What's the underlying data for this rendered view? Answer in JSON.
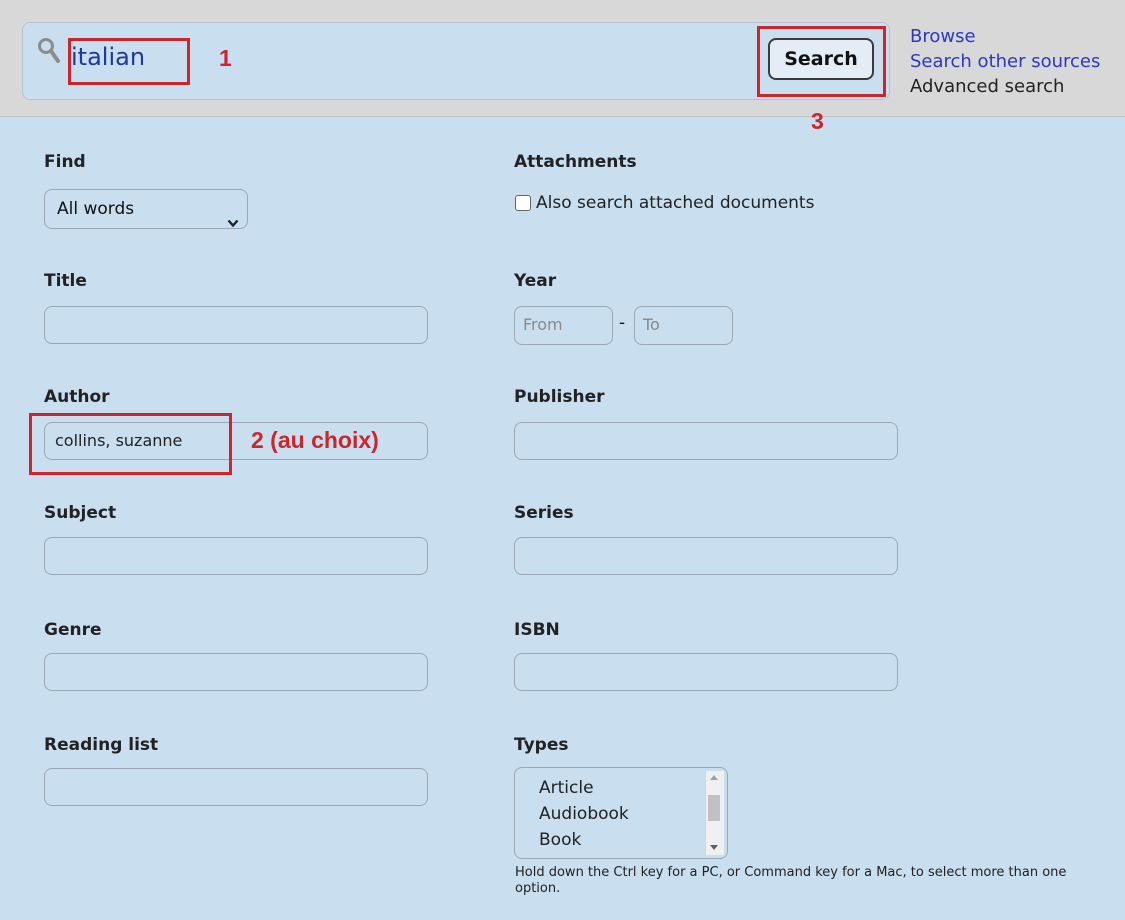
{
  "search": {
    "query": "italian",
    "button_label": "Search"
  },
  "top_links": {
    "browse": "Browse",
    "other_sources": "Search other sources",
    "advanced": "Advanced search"
  },
  "annotations": {
    "one": "1",
    "two": "2 (au choix)",
    "three": "3",
    "color": "#d0242b"
  },
  "form": {
    "find": {
      "label": "Find",
      "value": "All words"
    },
    "attachments": {
      "label": "Attachments",
      "checkbox_label": "Also search attached documents",
      "checked": false
    },
    "title": {
      "label": "Title",
      "value": ""
    },
    "year": {
      "label": "Year",
      "from_placeholder": "From",
      "to_placeholder": "To",
      "separator": "-"
    },
    "author": {
      "label": "Author",
      "value": "collins, suzanne"
    },
    "publisher": {
      "label": "Publisher",
      "value": ""
    },
    "subject": {
      "label": "Subject",
      "value": ""
    },
    "series": {
      "label": "Series",
      "value": ""
    },
    "genre": {
      "label": "Genre",
      "value": ""
    },
    "isbn": {
      "label": "ISBN",
      "value": ""
    },
    "reading_list": {
      "label": "Reading list",
      "value": ""
    },
    "types": {
      "label": "Types",
      "options": [
        "Article",
        "Audiobook",
        "Book"
      ],
      "hint": "Hold down the Ctrl key for a PC, or Command key for a Mac, to select more than one option."
    }
  },
  "colors": {
    "page_background": "#c9deef",
    "top_bar": "#d8d8d8",
    "link": "#2a37c9",
    "query_text": "#1f3a9a"
  },
  "icons": [
    "search-icon",
    "chevron-down-icon"
  ]
}
